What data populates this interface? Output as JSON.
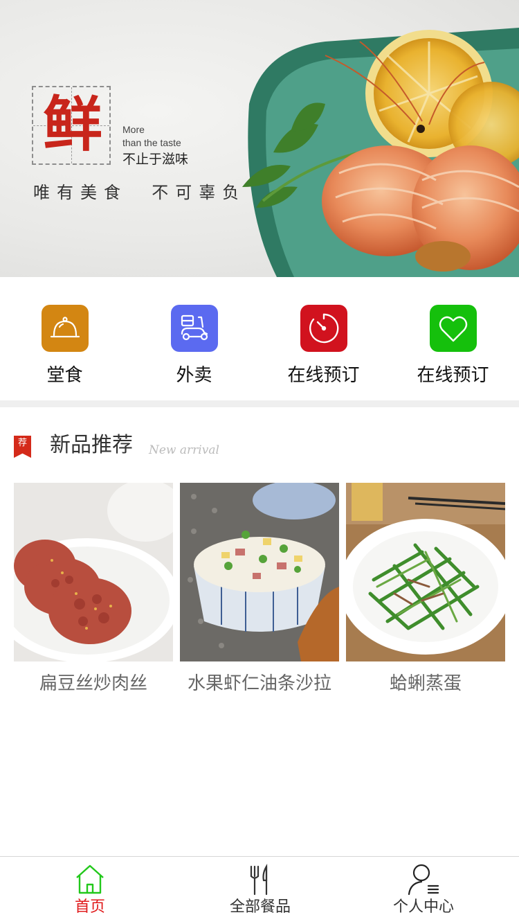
{
  "banner": {
    "stamp_char": "鲜",
    "line1": "More",
    "line2": "than the taste",
    "line3": "不止于滋味",
    "slogan": "唯有美食  不可辜负"
  },
  "quick_entries": [
    {
      "label": "堂食",
      "icon": "cloche-icon",
      "color": "#d38612"
    },
    {
      "label": "外卖",
      "icon": "scooter-icon",
      "color": "#5b6af0"
    },
    {
      "label": "在线预订",
      "icon": "timer-icon",
      "color": "#d1121e"
    },
    {
      "label": "在线预订",
      "icon": "heart-icon",
      "color": "#15c00c"
    }
  ],
  "section": {
    "badge": "荐",
    "title": "新品推荐",
    "subtitle": "New arrival"
  },
  "products": [
    {
      "name": "扁豆丝炒肉丝"
    },
    {
      "name": "水果虾仁油条沙拉"
    },
    {
      "name": "蛤蜊蒸蛋"
    }
  ],
  "tabbar": {
    "active_color": "#e0191a",
    "active_icon_color": "#22c81b",
    "items": [
      {
        "label": "首页",
        "icon": "home-icon",
        "active": true
      },
      {
        "label": "全部餐品",
        "icon": "fork-knife-icon",
        "active": false
      },
      {
        "label": "个人中心",
        "icon": "user-icon",
        "active": false
      }
    ]
  }
}
